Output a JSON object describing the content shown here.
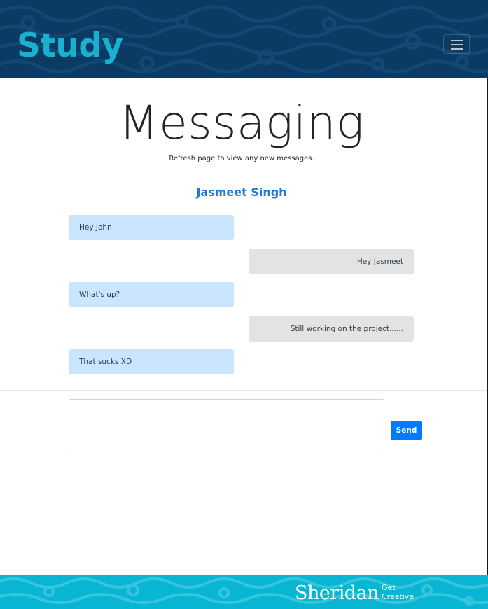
{
  "header": {
    "brand": "Study",
    "menu_icon": "hamburger-menu-icon",
    "colors": {
      "background": "#0b3a63",
      "brand": "#1ab0cf"
    }
  },
  "page": {
    "title": "Messaging",
    "subtitle": "Refresh page to view any new messages."
  },
  "conversation": {
    "contact_name": "Jasmeet Singh",
    "messages": [
      {
        "direction": "received",
        "text": "Hey John"
      },
      {
        "direction": "sent",
        "text": "Hey Jasmeet"
      },
      {
        "direction": "received",
        "text": "What's up?"
      },
      {
        "direction": "sent",
        "text": "Still working on the project......"
      },
      {
        "direction": "received",
        "text": "That sucks XD"
      }
    ],
    "colors": {
      "received": "#cce5ff",
      "sent": "#e2e3e5",
      "contact": "#1e7ad6"
    }
  },
  "compose": {
    "value": "",
    "send_label": "Send",
    "send_color": "#007bff"
  },
  "footer": {
    "logo_name": "Sheridan",
    "logo_tagline_1": "Get",
    "logo_tagline_2": "Creative",
    "background": "#08b6d4"
  }
}
